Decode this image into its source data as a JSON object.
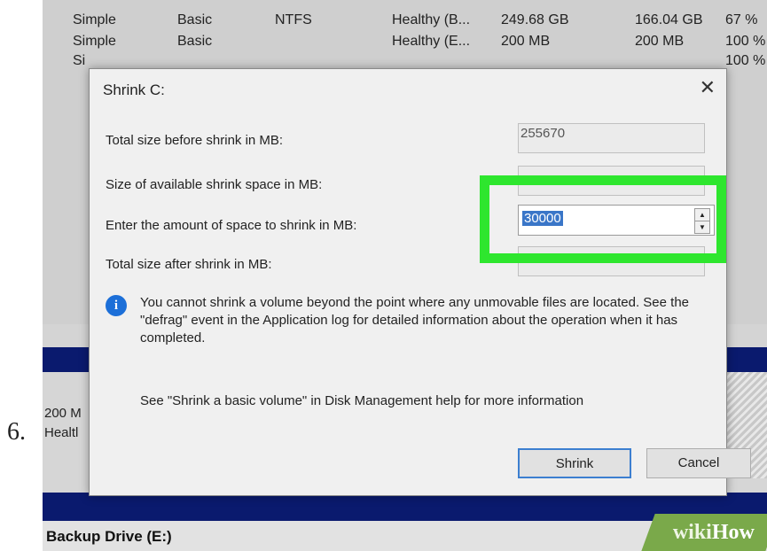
{
  "step_number": "6.",
  "volume_rows": [
    {
      "layout": "Simple",
      "type": "Basic",
      "fs": "NTFS",
      "status": "Healthy (B...",
      "capacity": "249.68 GB",
      "free": "166.04 GB",
      "pct": "67 %"
    },
    {
      "layout": "Simple",
      "type": "Basic",
      "fs": "",
      "status": "Healthy (E...",
      "capacity": "200 MB",
      "free": "200 MB",
      "pct": "100 %"
    },
    {
      "layout": "Si",
      "type": "",
      "fs": "",
      "status": "",
      "capacity": "",
      "free": "",
      "pct": "100 %"
    }
  ],
  "disk_area": {
    "line1": "200 M",
    "line2": "Healtl"
  },
  "bottom_bar": {
    "label": "Backup Drive  (E:)"
  },
  "watermark": {
    "wiki": "wiki",
    "how": "How"
  },
  "dialog": {
    "title": "Shrink C:",
    "close_glyph": "✕",
    "fields": [
      {
        "label": "Total size before shrink in MB:",
        "value": "255670"
      },
      {
        "label": "Size of available shrink space in MB:",
        "value": ""
      },
      {
        "label": "Enter the amount of space to shrink in MB:",
        "value": "30000"
      },
      {
        "label": "Total size after shrink in MB:",
        "value": ""
      }
    ],
    "info": "You cannot shrink a volume beyond the point where any unmovable files are located. See the \"defrag\" event in the Application log for detailed information about the operation when it has completed.",
    "help": "See \"Shrink a basic volume\" in Disk Management help for more information",
    "shrink_label": "Shrink",
    "cancel_label": "Cancel",
    "highlight_color": "#2ee62e"
  }
}
